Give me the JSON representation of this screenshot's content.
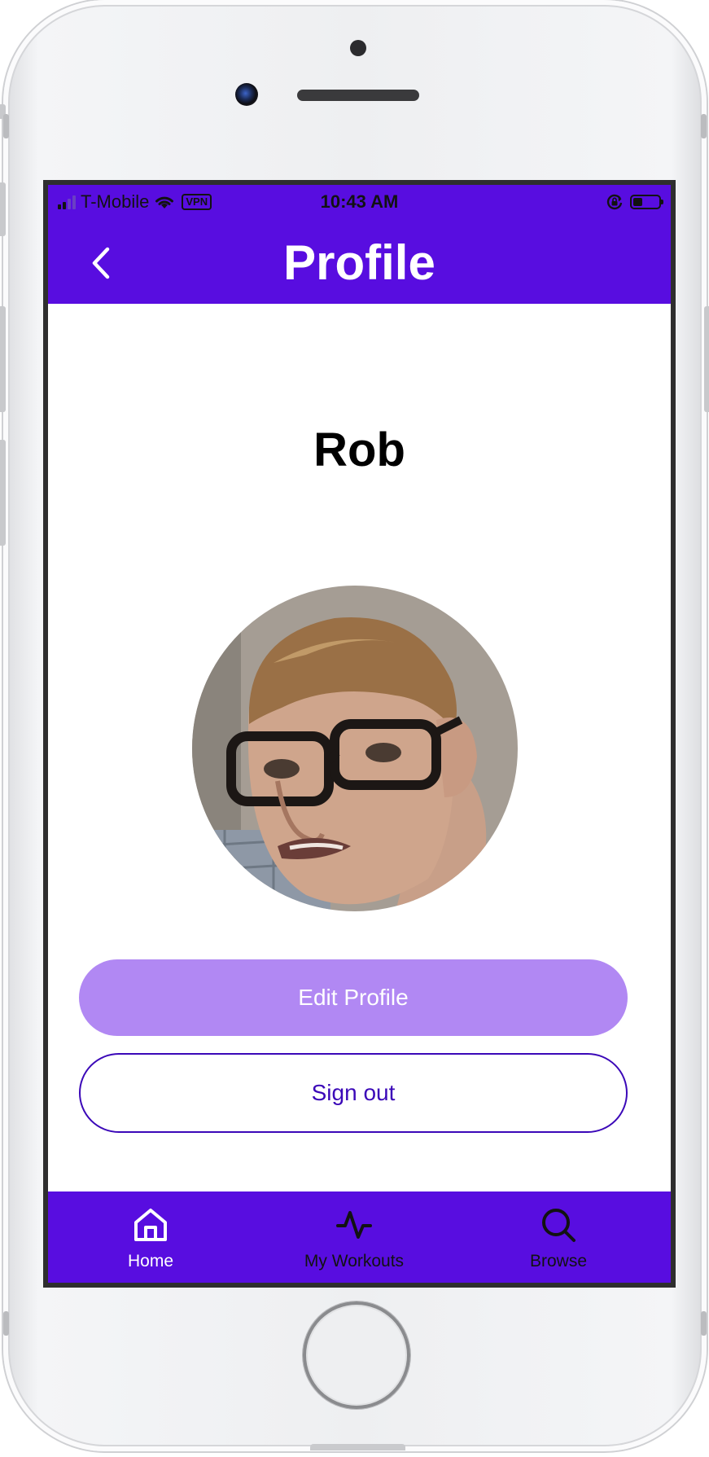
{
  "status_bar": {
    "carrier": "T-Mobile",
    "vpn": "VPN",
    "time": "10:43 AM",
    "signal_bars_filled": 2,
    "signal_bars_total": 4,
    "battery_level": 0.35
  },
  "nav": {
    "title": "Profile",
    "back_icon": "chevron-left-icon"
  },
  "profile": {
    "name": "Rob",
    "avatar_icon": "profile-photo"
  },
  "buttons": {
    "edit_label": "Edit Profile",
    "signout_label": "Sign out"
  },
  "tabs": [
    {
      "label": "Home",
      "icon": "home-icon",
      "active": true
    },
    {
      "label": "My Workouts",
      "icon": "activity-icon",
      "active": false
    },
    {
      "label": "Browse",
      "icon": "search-icon",
      "active": false
    }
  ],
  "colors": {
    "primary": "#580de0",
    "edit_button": "#b188f3",
    "signout_text": "#3b08b8"
  }
}
